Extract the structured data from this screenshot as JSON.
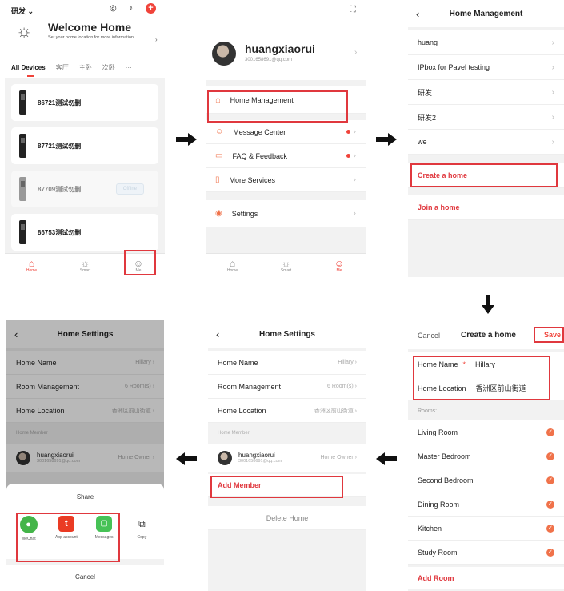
{
  "p1": {
    "location": "研发",
    "welcome_title": "Welcome Home",
    "welcome_sub": "Set your home location for more information",
    "tabs": [
      "All Devices",
      "客厅",
      "主卧",
      "次卧",
      "···"
    ],
    "devices": [
      {
        "name": "86721测试勿删",
        "status": ""
      },
      {
        "name": "87721测试勿删",
        "status": ""
      },
      {
        "name": "87709测试勿删",
        "status": "Offline"
      },
      {
        "name": "86753测试勿删",
        "status": ""
      }
    ],
    "tabbar": [
      "Home",
      "Smart",
      "Me"
    ]
  },
  "p2": {
    "username": "huangxiaorui",
    "email": "3001658691@qq.com",
    "menu": [
      "Home Management",
      "Message Center",
      "FAQ & Feedback",
      "More Services",
      "Settings"
    ],
    "tabbar": [
      "Home",
      "Smart",
      "Me"
    ]
  },
  "p3": {
    "title": "Home Management",
    "homes": [
      "huang",
      "IPbox for Pavel testing",
      "研发",
      "研发2",
      "we"
    ],
    "create": "Create a home",
    "join": "Join a home"
  },
  "p4": {
    "cancel": "Cancel",
    "title": "Create a home",
    "save": "Save",
    "name_label": "Home Name",
    "name_required": "*",
    "name_value": "Hillary",
    "location_label": "Home Location",
    "location_value": "香洲区前山街道",
    "rooms_label": "Rooms:",
    "rooms": [
      "Living Room",
      "Master Bedroom",
      "Second Bedroom",
      "Dining Room",
      "Kitchen",
      "Study Room"
    ],
    "add_room": "Add Room"
  },
  "p5": {
    "title": "Home Settings",
    "home_name_label": "Home Name",
    "home_name_value": "Hillary",
    "room_mgmt_label": "Room Management",
    "room_mgmt_value": "6 Room(s)",
    "location_label": "Home Location",
    "location_value": "香洲区前山街道",
    "member_header": "Home Member",
    "member_name": "huangxiaorui",
    "member_email": "3001658691@qq.com",
    "member_role": "Home Owner",
    "add_member": "Add Member",
    "delete_home": "Delete Home"
  },
  "p6": {
    "title": "Home Settings",
    "home_name_label": "Home Name",
    "home_name_value": "Hillary",
    "room_mgmt_label": "Room Management",
    "room_mgmt_value": "6 Room(s)",
    "location_label": "Home Location",
    "location_value": "香洲区前山街道",
    "member_header": "Home Member",
    "member_name": "huangxiaorui",
    "member_email": "3001658691@qq.com",
    "member_role": "Home Owner",
    "share_title": "Share",
    "share_options": [
      "WeChat",
      "App account",
      "Messages",
      "Copy"
    ],
    "cancel": "Cancel"
  },
  "colors": {
    "accent": "#f0433a",
    "highlight": "#e0383e",
    "check": "#f0724a"
  }
}
